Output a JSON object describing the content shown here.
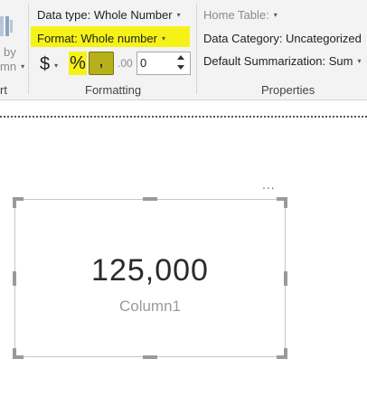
{
  "ribbon": {
    "partial_left": {
      "line1": "by",
      "line2": "mn",
      "group_suffix": "rt"
    },
    "formatting": {
      "data_type": "Data type: Whole Number",
      "format": "Format: Whole number",
      "currency_symbol": "$",
      "percent_symbol": "%",
      "comma_symbol": ",",
      "decimals_symbol": ".00",
      "decimal_places": "0",
      "group_label": "Formatting"
    },
    "properties": {
      "home_table": "Home Table:",
      "data_category": "Data Category: Uncategorized",
      "default_summarization": "Default Summarization: Sum",
      "group_label": "Properties"
    }
  },
  "card": {
    "more_options": "...",
    "value": "125,000",
    "label": "Column1"
  },
  "colors": {
    "highlight": "#f6f218",
    "comma_selected": "#b6b01a",
    "ribbon_bg": "#f3f3f3"
  }
}
